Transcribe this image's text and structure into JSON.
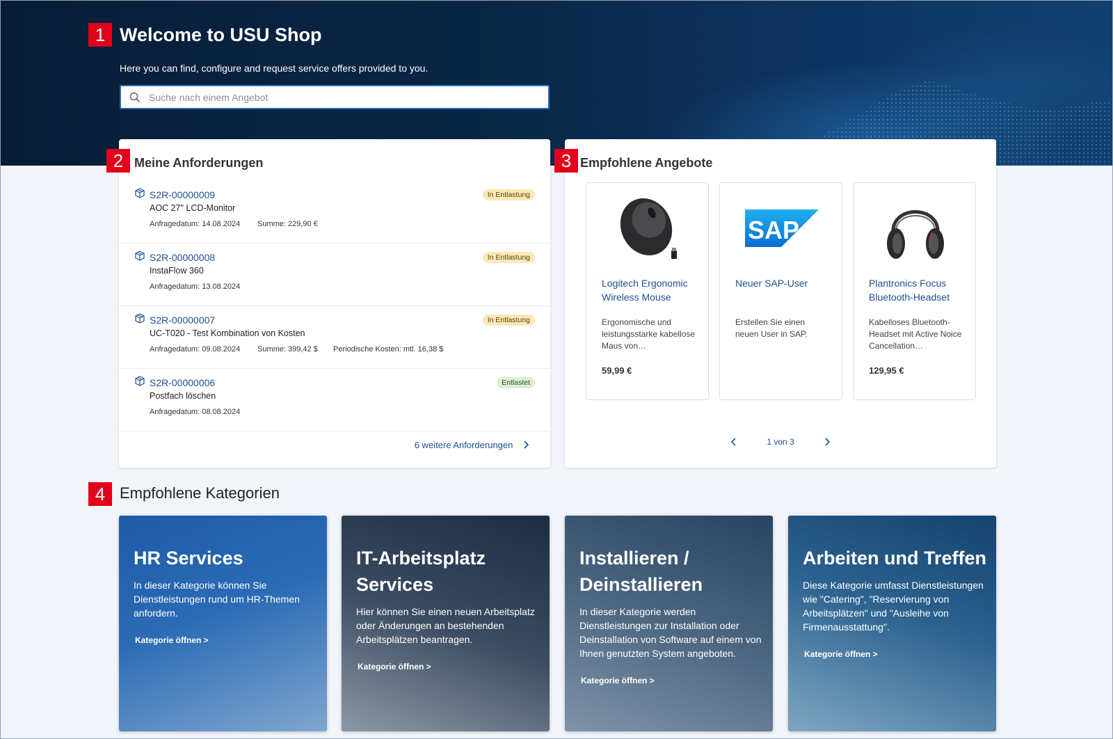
{
  "hero": {
    "title": "Welcome to USU Shop",
    "subtitle": "Here you can find, configure and request service offers provided to you.",
    "search_placeholder": "Suche nach einem Angebot"
  },
  "badges": [
    "1",
    "2",
    "3",
    "4"
  ],
  "requests": {
    "title": "Meine Anforderungen",
    "items": [
      {
        "id": "S2R-00000009",
        "name": "AOC 27\" LCD-Monitor",
        "date": "Anfragedatum: 14.08.2024",
        "sum": "Summe: 229,90 €",
        "periodic": "",
        "status": "In Entlastung"
      },
      {
        "id": "S2R-00000008",
        "name": "InstaFlow 360",
        "date": "Anfragedatum: 13.08.2024",
        "sum": "",
        "periodic": "",
        "status": "In Entlastung"
      },
      {
        "id": "S2R-00000007",
        "name": "UC-T020 - Test Kombination von Kosten",
        "date": "Anfragedatum: 09.08.2024",
        "sum": "Summe: 399,42 $",
        "periodic": "Periodische Kosten: mtl. 16,38 $",
        "status": "In Entlastung"
      },
      {
        "id": "S2R-00000006",
        "name": "Postfach löschen",
        "date": "Anfragedatum: 08.08.2024",
        "sum": "",
        "periodic": "",
        "status": "Entlastet"
      }
    ],
    "more_link": "6 weitere Anforderungen"
  },
  "offers": {
    "title": "Empfohlene Angebote",
    "items": [
      {
        "name": "Logitech Ergonomic Wireless Mouse",
        "desc": "Ergonomische und leistungsstarke kabellose Maus von…",
        "price": "59,99 €",
        "icon": "mouse-image"
      },
      {
        "name": "Neuer SAP-User",
        "desc": "Erstellen Sie einen neuen User in SAP.",
        "price": "",
        "icon": "sap-logo"
      },
      {
        "name": "Plantronics Focus Bluetooth-Headset",
        "desc": "Kabelloses Bluetooth-Headset mit Active Noice Cancellation…",
        "price": "129,95 €",
        "icon": "headset-image"
      }
    ],
    "pager": "1 von 3",
    "sap_logo_text": "SAP"
  },
  "categories": {
    "title": "Empfohlene Kategorien",
    "link_label": "Kategorie öffnen >",
    "items": [
      {
        "title": "HR Services",
        "desc": "In dieser Kategorie können Sie Dienstleistungen rund um HR-Themen anfordern."
      },
      {
        "title": "IT-Arbeitsplatz Services",
        "desc": "Hier können Sie einen neuen Arbeitsplatz oder Änderungen an bestehenden Arbeitsplätzen beantragen."
      },
      {
        "title": "Installieren / Deinstallieren",
        "desc": "In dieser Kategorie werden Dienstleistungen zur Installation oder Deinstallation von Software auf einem von Ihnen genutzten System angeboten."
      },
      {
        "title": "Arbeiten und Treffen",
        "desc": "Diese Kategorie umfasst Dienstleistungen wie \"Catering\", \"Reservierung von Arbeitsplätzen\" und \"Ausleihe von Firmenausstattung\"."
      }
    ]
  },
  "colors": {
    "accent": "#1d4f91",
    "badge": "#e3001b",
    "status_progress": "#fbe7b8",
    "status_done": "#dcefd4"
  }
}
